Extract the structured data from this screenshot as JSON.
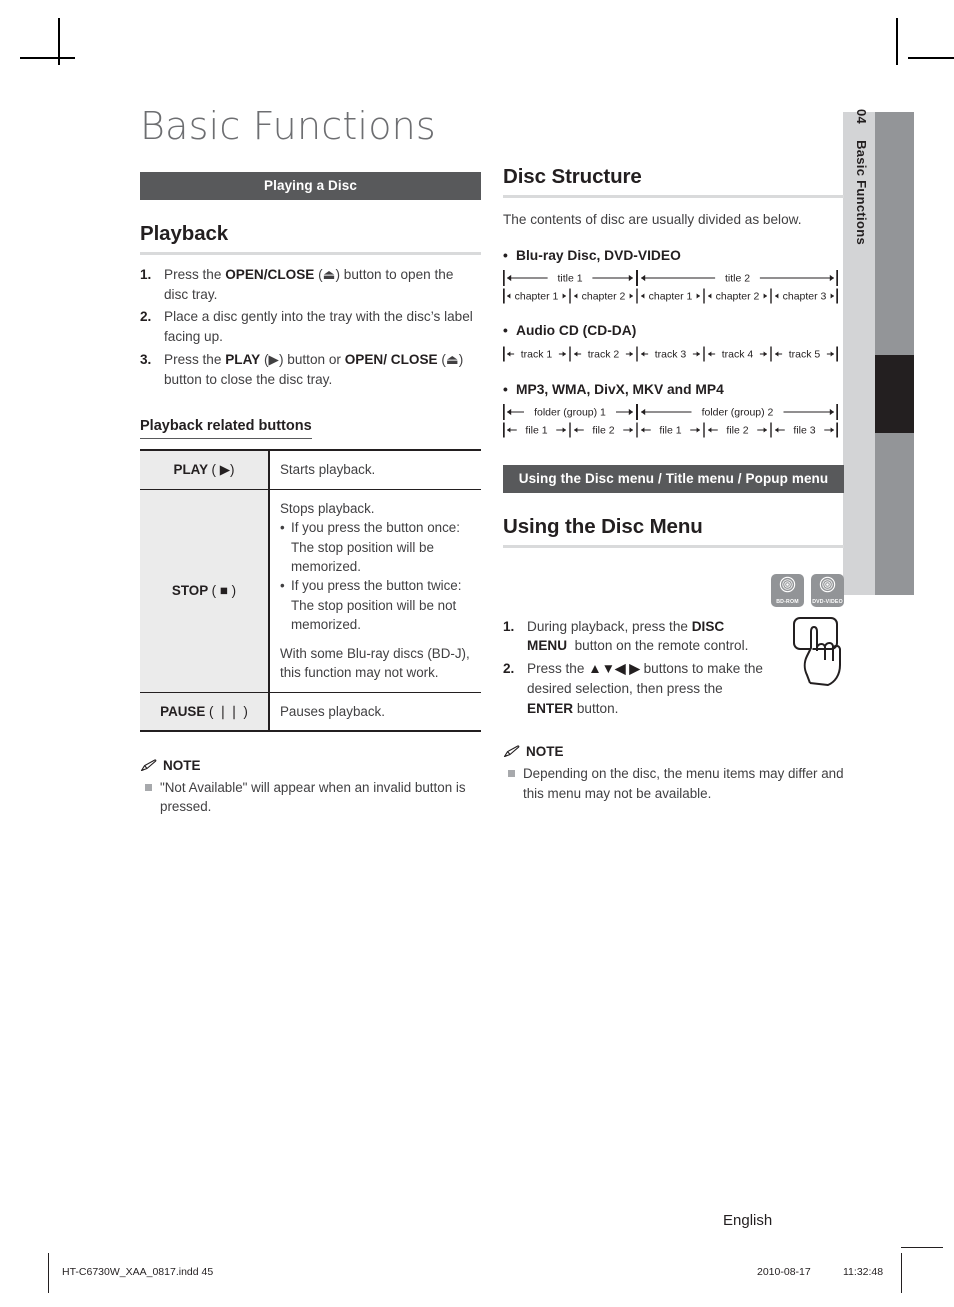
{
  "page": {
    "title": "Basic Functions",
    "language_footer": "English",
    "side_tab_number": "04",
    "side_tab_label": "Basic Functions",
    "footer_file": "HT-C6730W_XAA_0817.indd   45",
    "footer_date": "2010-08-17",
    "footer_time": "11:32:48"
  },
  "left": {
    "section_bar": "Playing a Disc",
    "playback_heading": "Playback",
    "playback_steps": [
      {
        "num": "1.",
        "html": "Press the <b>OPEN/CLOSE</b> (⏏) button to open the disc tray."
      },
      {
        "num": "2.",
        "html": "Place a disc gently into the tray with the disc’s label facing up."
      },
      {
        "num": "3.",
        "html": "Press the <b>PLAY</b> (▶) button or <b>OPEN/ CLOSE</b> (⏏) button to close the disc tray."
      }
    ],
    "table_heading": "Playback related buttons",
    "table_rows": [
      {
        "key": "PLAY",
        "key_symbol": "( ▶)",
        "lead": "Starts playback.",
        "bullets": [],
        "tail": ""
      },
      {
        "key": "STOP",
        "key_symbol": "( ■ )",
        "lead": "Stops playback.",
        "bullets": [
          "If you press the button once: The stop position will be memorized.",
          "If you press the button twice: The stop position will be not memorized."
        ],
        "tail": "With some Blu-ray discs (BD-J), this function may not work."
      },
      {
        "key": "PAUSE",
        "key_symbol": "( ❘❘ )",
        "lead": "Pauses playback.",
        "bullets": [],
        "tail": ""
      }
    ],
    "note_title": "NOTE",
    "note_items": [
      "\"Not Available\" will appear when an invalid button is pressed."
    ]
  },
  "right": {
    "disc_structure_heading": "Disc Structure",
    "disc_structure_intro": "The contents of disc are usually divided as below.",
    "groups": [
      {
        "label": "Blu-ray Disc, DVD-VIDEO",
        "top_row": [
          "title 1",
          "title 2"
        ],
        "bottom_row": [
          "chapter 1",
          "chapter 2",
          "chapter 1",
          "chapter 2",
          "chapter 3"
        ]
      },
      {
        "label": "Audio CD (CD-DA)",
        "top_row": [],
        "bottom_row": [
          "track 1",
          "track 2",
          "track 3",
          "track 4",
          "track 5"
        ]
      },
      {
        "label": "MP3, WMA, DivX, MKV and MP4",
        "top_row": [
          "folder (group) 1",
          "folder (group) 2"
        ],
        "bottom_row": [
          "file 1",
          "file 2",
          "file 1",
          "file 2",
          "file 3"
        ]
      }
    ],
    "section_bar": "Using the Disc menu / Title menu / Popup menu",
    "disc_menu_heading": "Using the Disc Menu",
    "badges": [
      {
        "label": "BD-ROM"
      },
      {
        "label": "DVD-VIDEO"
      }
    ],
    "menu_steps": [
      {
        "num": "1.",
        "html": "During playback, press the <b>DISC MENU</b>&nbsp; button on the remote control."
      },
      {
        "num": "2.",
        "html": "Press the <b>▲▼◀ ▶</b> buttons to make the desired selection, then press the <b>ENTER</b> button."
      }
    ],
    "note_title": "NOTE",
    "note_items": [
      "Depending on the disc, the menu items may differ and this menu may not be available."
    ]
  },
  "colors": {
    "section_bar": "#58595b",
    "heading_rule": "#d9dadb",
    "tab_light": "#d3d4d6",
    "tab_mid": "#939598",
    "tab_dark": "#231f20",
    "table_key_bg": "#ebebeb",
    "badge_bg": "#929497",
    "title_gray": "#6d6e71"
  }
}
